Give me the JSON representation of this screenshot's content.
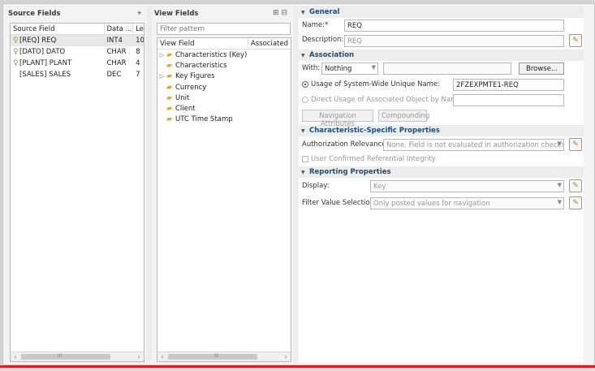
{
  "source_fields": {
    "title": "Source Fields",
    "columns": [
      "Source Field",
      "Data ...",
      "Le"
    ],
    "rows": [
      {
        "name": "[REQ] REQ",
        "type": "INT4",
        "len": "10",
        "key": true
      },
      {
        "name": "[DATO] DATO",
        "type": "CHAR",
        "len": "8",
        "key": true
      },
      {
        "name": "[PLANT] PLANT",
        "type": "CHAR",
        "len": "4",
        "key": true
      },
      {
        "name": "[SALES] SALES",
        "type": "DEC",
        "len": "7",
        "key": false
      }
    ],
    "scroll_label": "III"
  },
  "view_fields": {
    "title": "View Fields",
    "filter_placeholder": "Filter pattern",
    "columns": [
      "View Field",
      "Associated"
    ],
    "items": [
      {
        "label": "Characteristics (Key)",
        "expandable": true
      },
      {
        "label": "Characteristics",
        "expandable": false
      },
      {
        "label": "Key Figures",
        "expandable": true
      },
      {
        "label": "Currency",
        "expandable": false
      },
      {
        "label": "Unit",
        "expandable": false
      },
      {
        "label": "Client",
        "expandable": false
      },
      {
        "label": "UTC Time Stamp",
        "expandable": false
      }
    ],
    "scroll_label": "III"
  },
  "general": {
    "section": "General",
    "name_label": "Name:*",
    "name_value": "REQ",
    "description_label": "Description:",
    "description_placeholder": "REQ"
  },
  "association": {
    "section": "Association",
    "with_label": "With:",
    "with_value": "Nothing",
    "browse_label": "Browse...",
    "usage_label": "Usage of System-Wide Unique Name:",
    "usage_value": "2FZEXPMTE1-REQ",
    "direct_label": "Direct Usage of Associated Object by Name:",
    "nav_attr_label": "Navigation Attributes",
    "compounding_label": "Compounding"
  },
  "char_props": {
    "section": "Characteristic-Specific Properties",
    "auth_label": "Authorization Relevance:",
    "auth_value": "None. Field is not evaluated in authorization checks.",
    "ref_integrity_label": "User Confirmed Referential Integrity"
  },
  "reporting": {
    "section": "Reporting Properties",
    "display_label": "Display:",
    "display_value": "Key",
    "filter_label": "Filter Value Selection:",
    "filter_value": "Only posted values for navigation"
  },
  "colors": {
    "section_text": "#1e4d7b",
    "red_bar": "#e02020",
    "folder": "#d9a935",
    "key": "#c89016"
  }
}
